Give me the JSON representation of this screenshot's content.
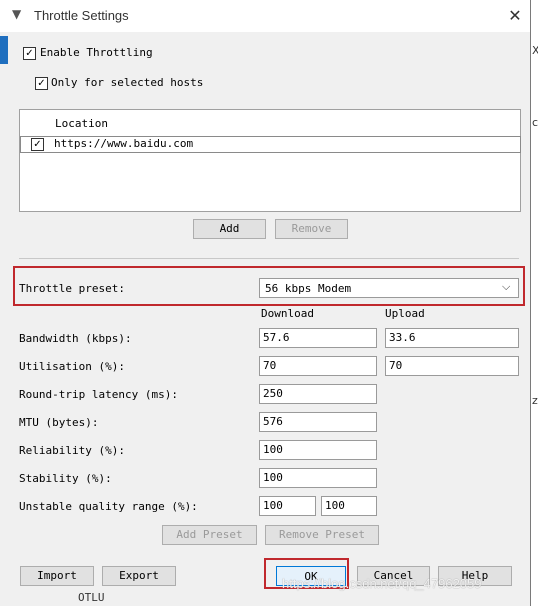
{
  "window": {
    "title": "Throttle Settings"
  },
  "enable_throttling": {
    "label": "Enable Throttling",
    "checked": true
  },
  "only_selected_hosts": {
    "label": "Only for selected hosts",
    "checked": true
  },
  "hosts_table": {
    "column": "Location",
    "rows": [
      {
        "checked": true,
        "location": "https://www.baidu.com"
      }
    ]
  },
  "host_buttons": {
    "add": "Add",
    "remove": "Remove"
  },
  "preset": {
    "label": "Throttle preset:",
    "value": "56 kbps Modem"
  },
  "columns": {
    "download": "Download",
    "upload": "Upload"
  },
  "settings": {
    "bandwidth": {
      "label": "Bandwidth (kbps):",
      "download": "57.6",
      "upload": "33.6"
    },
    "utilisation": {
      "label": "Utilisation (%):",
      "download": "70",
      "upload": "70"
    },
    "latency": {
      "label": "Round-trip latency (ms):",
      "value": "250"
    },
    "mtu": {
      "label": "MTU (bytes):",
      "value": "576"
    },
    "reliability": {
      "label": "Reliability (%):",
      "value": "100"
    },
    "stability": {
      "label": "Stability (%):",
      "value": "100"
    },
    "unstable_range": {
      "label": "Unstable quality range (%):",
      "min": "100",
      "max": "100"
    }
  },
  "preset_buttons": {
    "add": "Add Preset",
    "remove": "Remove Preset"
  },
  "footer": {
    "import": "Import",
    "export": "Export",
    "ok": "OK",
    "cancel": "Cancel",
    "help": "Help"
  },
  "watermark": "https://blog.csdn.net/qq_47962059",
  "background": {
    "right_marks": [
      "X",
      "c",
      "z"
    ],
    "bottom_text": "OTLU"
  },
  "colors": {
    "highlight": "#c0282d",
    "ok_border": "#0078d7"
  }
}
